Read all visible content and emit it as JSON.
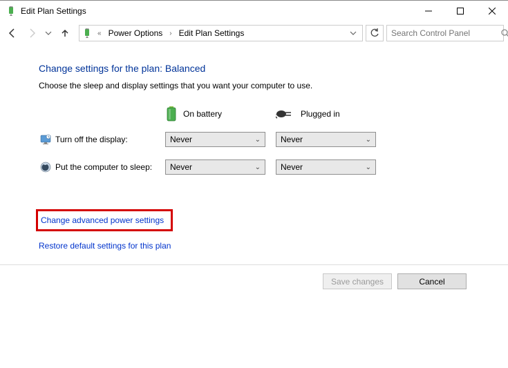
{
  "window": {
    "title": "Edit Plan Settings"
  },
  "breadcrumb": {
    "item1": "Power Options",
    "item2": "Edit Plan Settings"
  },
  "search": {
    "placeholder": "Search Control Panel"
  },
  "heading": "Change settings for the plan: Balanced",
  "subtext": "Choose the sleep and display settings that you want your computer to use.",
  "columns": {
    "battery": "On battery",
    "plugged": "Plugged in"
  },
  "rows": {
    "display_label": "Turn off the display:",
    "sleep_label": "Put the computer to sleep:"
  },
  "values": {
    "display_battery": "Never",
    "display_plugged": "Never",
    "sleep_battery": "Never",
    "sleep_plugged": "Never"
  },
  "links": {
    "advanced": "Change advanced power settings",
    "restore": "Restore default settings for this plan"
  },
  "buttons": {
    "save": "Save changes",
    "cancel": "Cancel"
  }
}
